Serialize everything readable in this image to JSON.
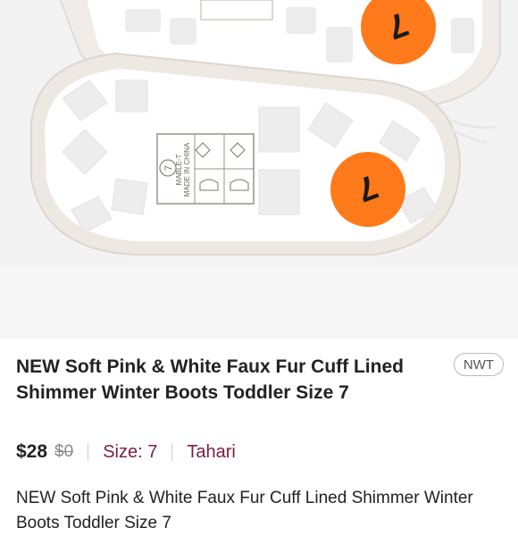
{
  "listing": {
    "title": "NEW Soft Pink & White Faux Fur Cuff Lined Shimmer Winter Boots Toddler Size 7",
    "condition_badge": "NWT",
    "price": "$28",
    "original_price": "$0",
    "size_label": "Size: 7",
    "brand": "Tahari",
    "description": "NEW Soft Pink & White Faux Fur Cuff Lined Shimmer Winter Boots Toddler Size 7"
  },
  "photo": {
    "size_sticker_top": "7",
    "size_sticker_bottom": "7",
    "sole_stamp_size": "7",
    "sole_stamp_line1": "MABLE-T",
    "sole_stamp_line2": "MADE IN CHINA",
    "sticker_color": "#ff7a1a"
  }
}
